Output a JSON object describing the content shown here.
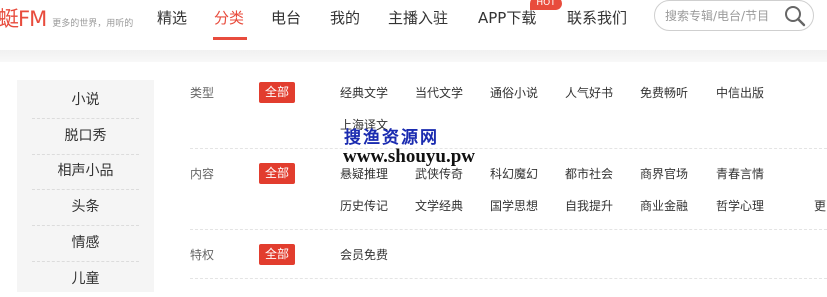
{
  "header": {
    "logo_text": "蜓FM",
    "logo_slogan": "更多的世界，用听的",
    "nav": [
      {
        "label": "精选"
      },
      {
        "label": "分类"
      },
      {
        "label": "电台"
      },
      {
        "label": "我的"
      },
      {
        "label": "主播入驻"
      },
      {
        "label": "APP下载"
      },
      {
        "label": "联系我们"
      }
    ],
    "active_nav": "分类",
    "hot_badge": "HOT",
    "search": {
      "placeholder": "搜索专辑/电台/节目"
    },
    "accent_color": "#e84c3d"
  },
  "sidebar": {
    "items": [
      {
        "label": "小说"
      },
      {
        "label": "脱口秀"
      },
      {
        "label": "相声小品"
      },
      {
        "label": "头条"
      },
      {
        "label": "情感"
      },
      {
        "label": "儿童"
      }
    ]
  },
  "filters": {
    "all_label": "全部",
    "rows": [
      {
        "label": "类型",
        "tags": [
          "经典文学",
          "当代文学",
          "通俗小说",
          "人气好书",
          "免费畅听",
          "中信出版",
          "上海译文"
        ]
      },
      {
        "label": "内容",
        "tags": [
          "悬疑推理",
          "武侠传奇",
          "科幻魔幻",
          "都市社会",
          "商界官场",
          "青春言情",
          "历史传记",
          "文学经典",
          "国学思想",
          "自我提升",
          "商业金融",
          "哲学心理",
          "更"
        ]
      },
      {
        "label": "特权",
        "tags": [
          "会员免费"
        ]
      }
    ]
  },
  "watermark": {
    "line1": "搜渔资源网",
    "line2": "www.shouyu.pw"
  }
}
